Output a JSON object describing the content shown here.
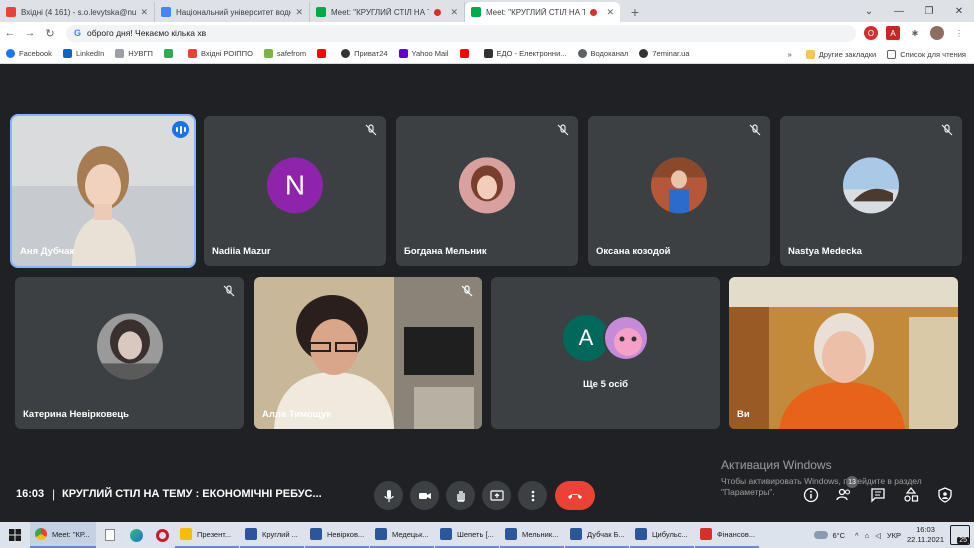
{
  "browser": {
    "tabs": [
      {
        "title": "Вхідні (4 161) - s.o.levytska@nuwm.edu.ua",
        "icon_color": "#ea4335",
        "active": false,
        "recording": false
      },
      {
        "title": "Національний університет водного господарства",
        "icon_color": "#4285f4",
        "active": false,
        "recording": false
      },
      {
        "title": "Meet: \"КРУГЛИЙ СТІЛ НА ТЕМУ",
        "icon_color": "#00ac47",
        "active": false,
        "recording": true
      },
      {
        "title": "Meet: \"КРУГЛИЙ СТІЛ НА ТЕМУ",
        "icon_color": "#00ac47",
        "active": true,
        "recording": true
      }
    ],
    "new_tab": "+",
    "omnibox_text": "оброго дня! Чекаємо кілька хв",
    "bookmarks": [
      {
        "label": "Facebook",
        "icon_color": "#1877f2"
      },
      {
        "label": "LinkedIn",
        "icon_color": "#0a66c2"
      },
      {
        "label": "НУВГП",
        "icon_color": "#9aa0a6"
      },
      {
        "label": "",
        "icon_color": "#34a853"
      },
      {
        "label": "Вхідні РОІППО",
        "icon_color": "#ea4335"
      },
      {
        "label": "safefrom",
        "icon_color": "#7cb342"
      },
      {
        "label": "",
        "icon_color": "#ff0000"
      },
      {
        "label": "Приват24",
        "icon_color": "#333333"
      },
      {
        "label": "Yahoo Mail",
        "icon_color": "#6001d2"
      },
      {
        "label": "",
        "icon_color": "#ff0000"
      },
      {
        "label": "ЕДО - Електронни...",
        "icon_color": "#333333"
      },
      {
        "label": "Водоканал",
        "icon_color": "#5f6368"
      },
      {
        "label": "7eminar.ua",
        "icon_color": "#333333"
      }
    ],
    "bookmarks_overflow": "»",
    "other_bookmarks": "Другие закладки",
    "reading_list": "Список для чтения"
  },
  "meet": {
    "participants": [
      {
        "name": "Аня Дубчак",
        "type": "video",
        "speaking": true,
        "muted": false
      },
      {
        "name": "Nadiia Mazur",
        "type": "letter",
        "letter": "N",
        "color": "#8e24aa",
        "muted": true
      },
      {
        "name": "Богдана Мельник",
        "type": "photo",
        "color": "#c98a8a",
        "muted": true
      },
      {
        "name": "Оксана козодой",
        "type": "photo",
        "color": "#b5583a",
        "muted": true
      },
      {
        "name": "Nastya Medecka",
        "type": "photo",
        "color": "#8fb8d9",
        "muted": true
      },
      {
        "name": "Катерина Невірковець",
        "type": "photo",
        "color": "#6b6b6b",
        "muted": true
      },
      {
        "name": "Алла Тимощук",
        "type": "video",
        "muted": true
      },
      {
        "name": "Ще 5 осіб",
        "type": "group",
        "letter": "A",
        "color": "#00695c"
      },
      {
        "name": "Ви",
        "type": "video",
        "muted": false
      }
    ],
    "time": "16:03",
    "separator": "|",
    "title": "КРУГЛИЙ СТІЛ НА ТЕМУ : ЕКОНОМІЧНІ РЕБУС...",
    "participants_count": "13",
    "activation_title": "Активация Windows",
    "activation_text_1": "Чтобы активировать Windows, перейдите в раздел",
    "activation_text_2": "\"Параметры\"."
  },
  "taskbar": {
    "apps": [
      {
        "label": "Meet: \"КР...",
        "icon_color": "#4285f4",
        "active": true
      },
      {
        "label": "Презент...",
        "icon_color": "#fbbc04",
        "active": false
      },
      {
        "label": "Круглий ...",
        "icon_color": "#2b579a",
        "active": false
      },
      {
        "label": "Невірков...",
        "icon_color": "#2b579a",
        "active": false
      },
      {
        "label": "Медецьк...",
        "icon_color": "#2b579a",
        "active": false
      },
      {
        "label": "Шепеть [...",
        "icon_color": "#2b579a",
        "active": false
      },
      {
        "label": "Мельник...",
        "icon_color": "#2b579a",
        "active": false
      },
      {
        "label": "Дубчак Б...",
        "icon_color": "#2b579a",
        "active": false
      },
      {
        "label": "Цибульс...",
        "icon_color": "#2b579a",
        "active": false
      },
      {
        "label": "Фінансов...",
        "icon_color": "#d93025",
        "active": false
      }
    ],
    "weather": "6°C",
    "language": "УКР",
    "time": "16:03",
    "date": "22.11.2021",
    "notifications": "25"
  }
}
